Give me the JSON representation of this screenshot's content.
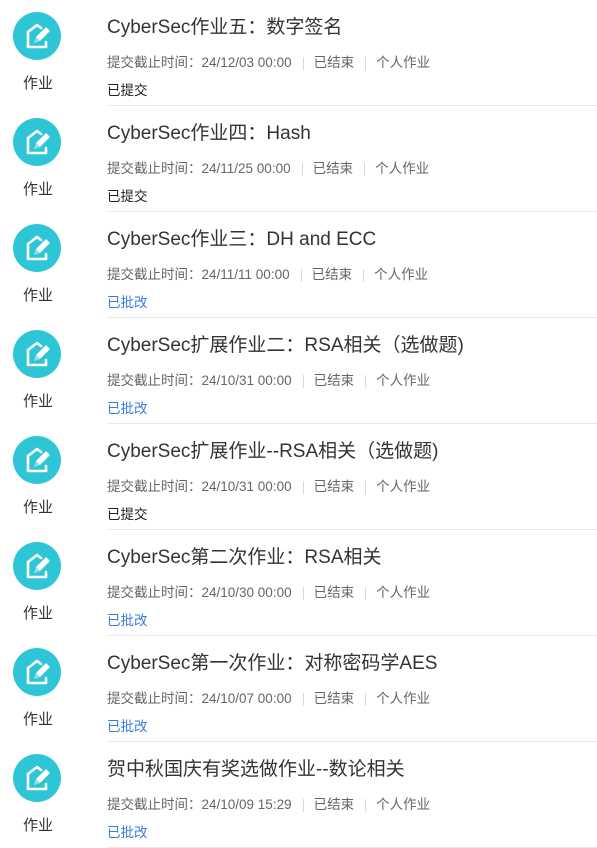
{
  "colors": {
    "icon_bg": "#2ec6d6",
    "graded_status": "#3a7be0",
    "submitted_status": "#222222"
  },
  "assignments": [
    {
      "icon": "pen-edit-icon",
      "type_label": "作业",
      "title": "CyberSec作业五：数字签名",
      "deadline": "提交截止时间：24/12/03 00:00",
      "state": "已结束",
      "mode": "个人作业",
      "status": "已提交",
      "status_kind": "submitted"
    },
    {
      "icon": "pen-edit-icon",
      "type_label": "作业",
      "title": "CyberSec作业四：Hash",
      "deadline": "提交截止时间：24/11/25 00:00",
      "state": "已结束",
      "mode": "个人作业",
      "status": "已提交",
      "status_kind": "submitted"
    },
    {
      "icon": "pen-edit-icon",
      "type_label": "作业",
      "title": "CyberSec作业三：DH and ECC",
      "deadline": "提交截止时间：24/11/11 00:00",
      "state": "已结束",
      "mode": "个人作业",
      "status": "已批改",
      "status_kind": "graded"
    },
    {
      "icon": "pen-edit-icon",
      "type_label": "作业",
      "title": "CyberSec扩展作业二：RSA相关（选做题)",
      "deadline": "提交截止时间：24/10/31 00:00",
      "state": "已结束",
      "mode": "个人作业",
      "status": "已批改",
      "status_kind": "graded"
    },
    {
      "icon": "pen-edit-icon",
      "type_label": "作业",
      "title": "CyberSec扩展作业--RSA相关（选做题)",
      "deadline": "提交截止时间：24/10/31 00:00",
      "state": "已结束",
      "mode": "个人作业",
      "status": "已提交",
      "status_kind": "submitted"
    },
    {
      "icon": "pen-edit-icon",
      "type_label": "作业",
      "title": "CyberSec第二次作业：RSA相关",
      "deadline": "提交截止时间：24/10/30 00:00",
      "state": "已结束",
      "mode": "个人作业",
      "status": "已批改",
      "status_kind": "graded"
    },
    {
      "icon": "pen-edit-icon",
      "type_label": "作业",
      "title": "CyberSec第一次作业：对称密码学AES",
      "deadline": "提交截止时间：24/10/07 00:00",
      "state": "已结束",
      "mode": "个人作业",
      "status": "已批改",
      "status_kind": "graded"
    },
    {
      "icon": "pen-edit-icon",
      "type_label": "作业",
      "title": "贺中秋国庆有奖选做作业--数论相关",
      "deadline": "提交截止时间：24/10/09 15:29",
      "state": "已结束",
      "mode": "个人作业",
      "status": "已批改",
      "status_kind": "graded"
    }
  ]
}
